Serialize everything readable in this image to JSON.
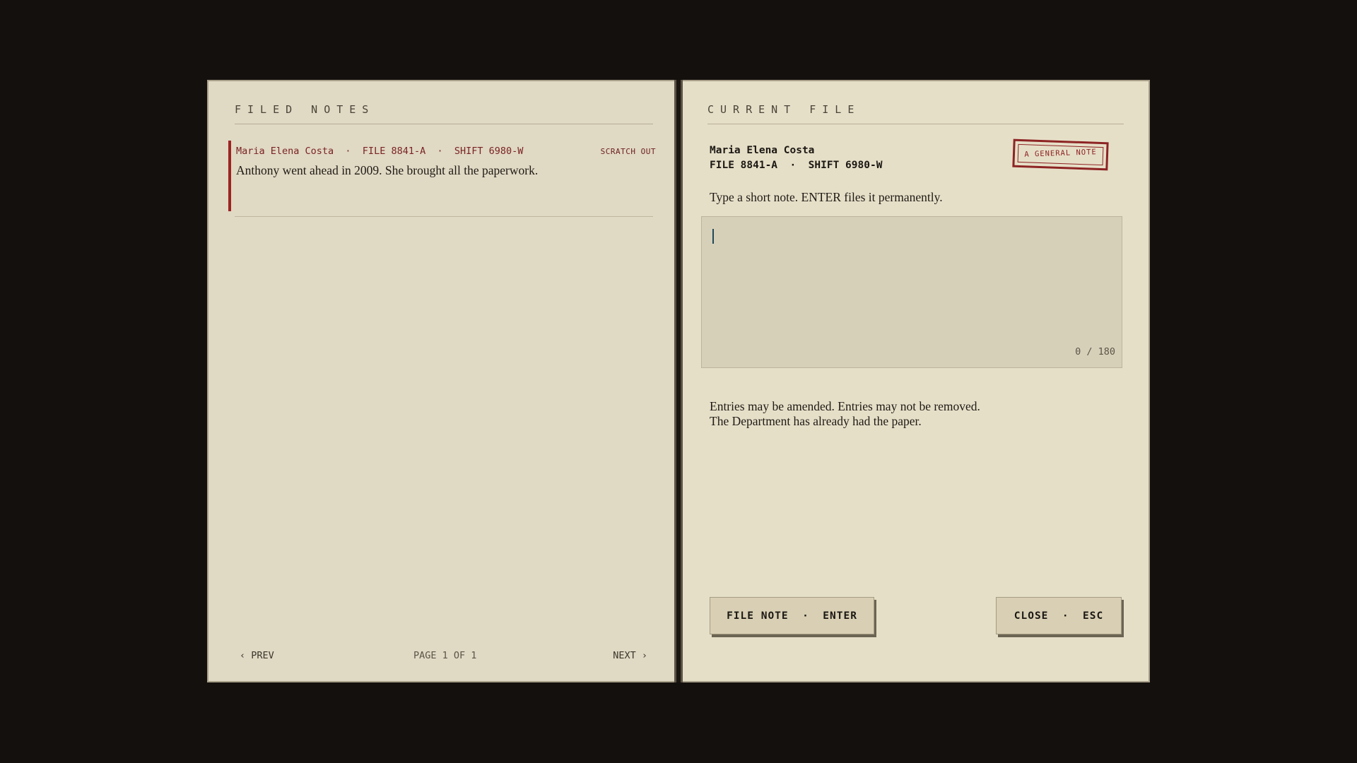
{
  "left_page": {
    "title": "FILED NOTES",
    "notes": [
      {
        "meta": "Maria Elena Costa  ·  FILE 8841-A  ·  SHIFT 6980-W",
        "action": "SCRATCH OUT",
        "text": "Anthony went ahead in 2009. She brought all the paperwork."
      }
    ],
    "pager": {
      "prev": "‹ PREV",
      "info": "PAGE 1 OF 1",
      "next": "NEXT ›"
    }
  },
  "right_page": {
    "title": "CURRENT FILE",
    "name": "Maria Elena Costa",
    "ids": "FILE 8841-A  ·  SHIFT 6980-W",
    "stamp": "A GENERAL NOTE",
    "instruction": "Type a short note. ENTER files it permanently.",
    "note_input": {
      "value": "",
      "counter": "0 / 180"
    },
    "policy_line1": "Entries may be amended. Entries may not be removed.",
    "policy_line2": "The Department has already had the paper.",
    "file_button": "FILE NOTE  ·  ENTER",
    "close_button": "CLOSE  ·  ESC"
  },
  "colors": {
    "background": "#14100d",
    "paper": "#e0d9c4",
    "accent_red": "#9d2424"
  }
}
